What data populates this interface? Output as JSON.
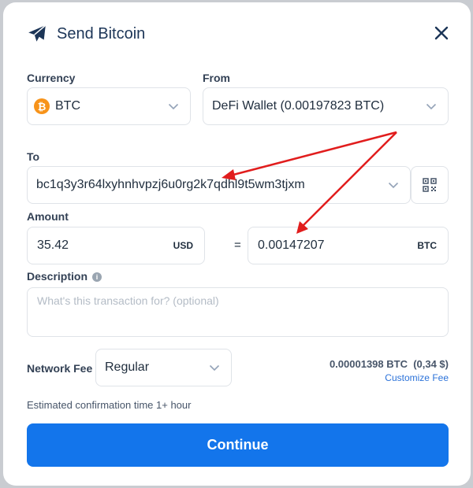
{
  "dialog": {
    "title": "Send Bitcoin",
    "icons": {
      "header": "paper-plane-icon",
      "close": "close-icon"
    }
  },
  "currency": {
    "label": "Currency",
    "value": "BTC",
    "icon": "bitcoin-icon"
  },
  "from": {
    "label": "From",
    "value": "DeFi Wallet (0.00197823 BTC)"
  },
  "to": {
    "label": "To",
    "value": "bc1q3y3r64lxyhnhvpzj6u0rg2k7qdhl9t5wm3tjxm",
    "qr_icon": "qr-code-icon"
  },
  "amount": {
    "label": "Amount",
    "fiat_value": "35.42",
    "fiat_unit": "USD",
    "equals": "=",
    "crypto_value": "0.00147207",
    "crypto_unit": "BTC"
  },
  "description": {
    "label": "Description",
    "info_glyph": "i",
    "placeholder": "What's this transaction for? (optional)"
  },
  "network_fee": {
    "label": "Network Fee",
    "selected": "Regular",
    "amount": "0.00001398 BTC  (0,34 $)",
    "customize_link": "Customize Fee"
  },
  "estimate": "Estimated confirmation time 1+ hour",
  "continue_label": "Continue",
  "colors": {
    "primary": "#1375eb",
    "link": "#2b72d9",
    "bitcoin": "#f7931a",
    "annotation_arrow": "#e11d1d"
  }
}
